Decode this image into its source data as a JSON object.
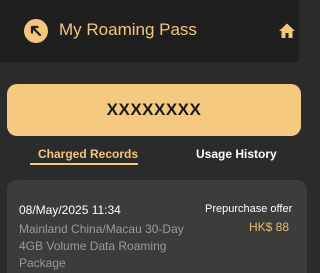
{
  "header": {
    "title": "My Roaming Pass",
    "back_icon": "arrow-up-left-icon",
    "home_icon": "home-icon"
  },
  "pass": {
    "number": "XXXXXXXX"
  },
  "tabs": [
    {
      "label": "Charged Records",
      "active": true
    },
    {
      "label": "Usage History",
      "active": false
    }
  ],
  "records": [
    {
      "date": "08/May/2025 11:34",
      "description": "Mainland China/Macau 30-Day 4GB Volume Data Roaming Package",
      "type": "Prepurchase offer",
      "price": "HK$ 88"
    }
  ],
  "colors": {
    "accent": "#f4c57c",
    "card": "#f5c97f",
    "background": "#2b2b2b",
    "header": "#1f1f1f",
    "record": "#3c3c3c"
  }
}
